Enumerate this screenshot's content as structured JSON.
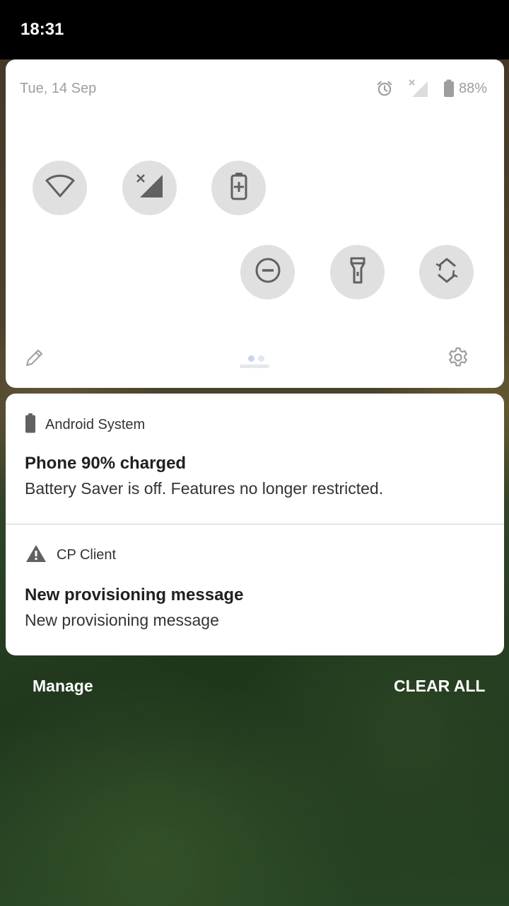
{
  "status_bar": {
    "time": "18:31"
  },
  "quick_settings": {
    "date": "Tue, 14 Sep",
    "battery_percent": "88%",
    "tiles": [
      {
        "name": "wifi-icon"
      },
      {
        "name": "mobile-data-off-icon"
      },
      {
        "name": "battery-saver-icon"
      },
      {
        "name": "do-not-disturb-icon"
      },
      {
        "name": "flashlight-icon"
      },
      {
        "name": "auto-rotate-icon"
      }
    ],
    "page_indicator": {
      "pages": 2,
      "current": 1
    }
  },
  "notifications": [
    {
      "app": "Android System",
      "app_icon": "battery-icon",
      "title": "Phone 90% charged",
      "text": "Battery Saver is off. Features no longer restricted."
    },
    {
      "app": "CP Client",
      "app_icon": "warning-icon",
      "title": "New provisioning message",
      "text": "New provisioning message"
    }
  ],
  "footer": {
    "manage_label": "Manage",
    "clear_all_label": "CLEAR ALL"
  },
  "colors": {
    "tile_bg": "#e0e0e0",
    "icon_dark": "#616161",
    "pager_active": "#c7d5ef",
    "pager_inactive": "#e0e6f1"
  }
}
